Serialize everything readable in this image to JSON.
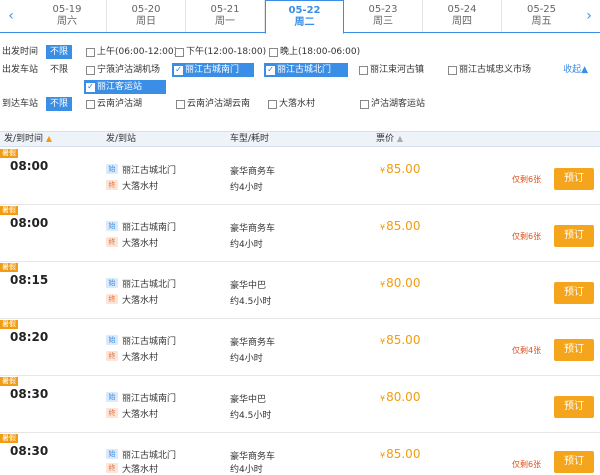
{
  "dates": [
    {
      "date": "05-19",
      "weekday": "周六",
      "active": false
    },
    {
      "date": "05-20",
      "weekday": "周日",
      "active": false
    },
    {
      "date": "05-21",
      "weekday": "周一",
      "active": false
    },
    {
      "date": "05-22",
      "weekday": "周二",
      "active": true
    },
    {
      "date": "05-23",
      "weekday": "周三",
      "active": false
    },
    {
      "date": "05-24",
      "weekday": "周四",
      "active": false
    },
    {
      "date": "05-25",
      "weekday": "周五",
      "active": false
    }
  ],
  "nav": {
    "prev_icon": "‹",
    "next_icon": "›"
  },
  "filters": {
    "depart_time": {
      "label": "出发时间",
      "any": "不限",
      "options": [
        "上午(06:00-12:00)",
        "下午(12:00-18:00)",
        "晚上(18:00-06:00)"
      ]
    },
    "depart_station": {
      "label": "出发车站",
      "any": "不限",
      "options": [
        {
          "text": "宁蒗泸沽湖机场",
          "checked": false
        },
        {
          "text": "丽江古城南门",
          "checked": true
        },
        {
          "text": "丽江古城北门",
          "checked": true
        },
        {
          "text": "丽江束河古镇",
          "checked": false
        },
        {
          "text": "丽江古城忠义市场",
          "checked": false
        },
        {
          "text": "丽江客运站",
          "checked": true
        }
      ],
      "collapse": "收起▲"
    },
    "arrive_station": {
      "label": "到达车站",
      "any": "不限",
      "options": [
        "云南泸沽湖",
        "云南泸沽湖云南",
        "大落水村",
        "泸沽湖客运站"
      ]
    }
  },
  "table": {
    "headers": {
      "time": "发/到时间",
      "station": "发/到站",
      "vehicle": "车型/耗时",
      "price": "票价"
    },
    "sort_up_icon": "▲",
    "sort_grey_icon": "▲",
    "rows": [
      {
        "tag": "暑假",
        "time": "08:00",
        "dep_badge": "始",
        "dep": "丽江古城北门",
        "arr_badge": "终",
        "arr": "大落水村",
        "vehicle": "豪华商务车",
        "duration": "约4小时",
        "yen": "¥",
        "price": "85.00",
        "remain": "仅剩6张",
        "book": "预订"
      },
      {
        "tag": "暑假",
        "time": "08:00",
        "dep_badge": "始",
        "dep": "丽江古城南门",
        "arr_badge": "终",
        "arr": "大落水村",
        "vehicle": "豪华商务车",
        "duration": "约4小时",
        "yen": "¥",
        "price": "85.00",
        "remain": "仅剩6张",
        "book": "预订"
      },
      {
        "tag": "暑假",
        "time": "08:15",
        "dep_badge": "始",
        "dep": "丽江古城北门",
        "arr_badge": "终",
        "arr": "大落水村",
        "vehicle": "豪华中巴",
        "duration": "约4.5小时",
        "yen": "¥",
        "price": "80.00",
        "remain": "",
        "book": "预订"
      },
      {
        "tag": "暑假",
        "time": "08:20",
        "dep_badge": "始",
        "dep": "丽江古城南门",
        "arr_badge": "终",
        "arr": "大落水村",
        "vehicle": "豪华商务车",
        "duration": "约4小时",
        "yen": "¥",
        "price": "85.00",
        "remain": "仅剩4张",
        "book": "预订"
      },
      {
        "tag": "暑假",
        "time": "08:30",
        "dep_badge": "始",
        "dep": "丽江古城南门",
        "arr_badge": "终",
        "arr": "大落水村",
        "vehicle": "豪华中巴",
        "duration": "约4.5小时",
        "yen": "¥",
        "price": "80.00",
        "remain": "",
        "book": "预订"
      },
      {
        "tag": "暑假",
        "time": "08:30",
        "dep_badge": "始",
        "dep": "丽江古城北门",
        "arr_badge": "终",
        "arr": "大落水村",
        "vehicle": "豪华商务车",
        "duration": "约4小时",
        "yen": "¥",
        "price": "85.00",
        "remain": "仅剩6张",
        "book": "预订"
      }
    ]
  }
}
